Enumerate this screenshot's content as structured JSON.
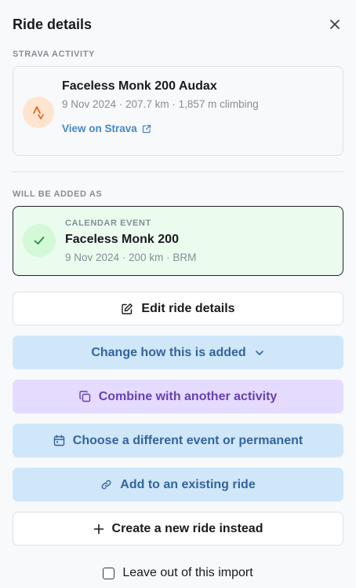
{
  "header": {
    "title": "Ride details"
  },
  "strava_section": {
    "label": "STRAVA ACTIVITY",
    "activity_title": "Faceless Monk 200 Audax",
    "activity_meta": "9 Nov 2024 · 207.7 km · 1,857 m climbing",
    "link_label": "View on Strava"
  },
  "added_section": {
    "label": "WILL BE ADDED AS",
    "event_type": "CALENDAR EVENT",
    "event_title": "Faceless Monk 200",
    "event_meta": "9 Nov 2024 · 200 km · BRM"
  },
  "actions": {
    "edit": "Edit ride details",
    "change": "Change how this is added",
    "combine": "Combine with another activity",
    "choose": "Choose a different event or permanent",
    "add_existing": "Add to an existing ride",
    "create_new": "Create a new ride instead",
    "leave_out": "Leave out of this import"
  },
  "icons": {
    "close": "close-icon",
    "strava": "strava-icon",
    "external": "external-link-icon",
    "check": "check-icon",
    "edit": "edit-icon",
    "chevron": "chevron-down-icon",
    "combine": "copy-icon",
    "calendar": "calendar-icon",
    "link": "link-icon",
    "plus": "plus-icon"
  },
  "colors": {
    "strava_orange": "#e8590c",
    "success_green": "#2b8a3e",
    "blue_action": "#33649b",
    "purple_action": "#6741b0"
  }
}
